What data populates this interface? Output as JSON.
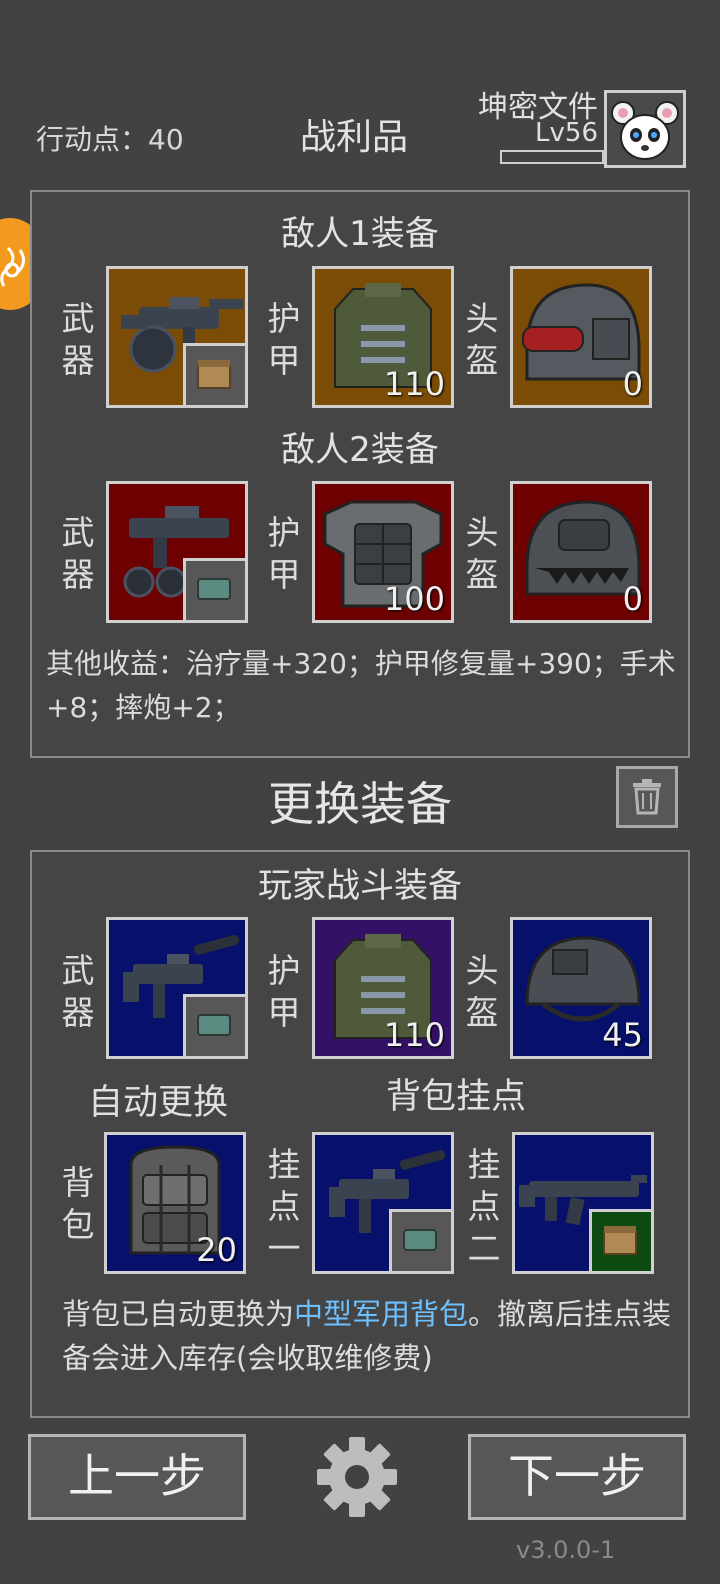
{
  "header": {
    "action_points": "行动点：40",
    "title": "战利品",
    "profile_name": "坤密文件",
    "profile_level": "Lv56"
  },
  "loot": {
    "enemy1_title": "敌人1装备",
    "enemy2_title": "敌人2装备",
    "labels": {
      "weapon": "武器",
      "armor": "护甲",
      "helmet": "头盔"
    },
    "enemy1": {
      "armor_value": "110",
      "helmet_value": "0"
    },
    "enemy2": {
      "armor_value": "100",
      "helmet_value": "0"
    },
    "other_income": "其他收益：治疗量+320；护甲修复量+390；手术+8；摔炮+2；"
  },
  "change": {
    "title": "更换装备",
    "player_title": "玩家战斗装备",
    "labels": {
      "weapon": "武器",
      "armor": "护甲",
      "helmet": "头盔",
      "backpack": "背包",
      "mount1": "挂点一",
      "mount2": "挂点二"
    },
    "armor_value": "110",
    "helmet_value": "45",
    "backpack_value": "20",
    "auto_label": "自动更换",
    "mount_label": "背包挂点",
    "notice_prefix": "背包已自动更换为",
    "notice_highlight": "中型军用背包",
    "notice_suffix": "。撤离后挂点装备会进入库存(会收取维修费)"
  },
  "footer": {
    "prev_label": "上一步",
    "next_label": "下一步",
    "version": "v3.0.0-1"
  },
  "colors": {
    "background": "#424242",
    "rarity_orange": "#7a4c06",
    "rarity_red": "#6d0000",
    "rarity_blue": "#07106a",
    "rarity_purple": "#331266",
    "highlight_text": "#6ec0ff",
    "badge": "#f39a1e"
  },
  "icons": {
    "trash": "trash-icon",
    "settings": "gear-icon"
  }
}
